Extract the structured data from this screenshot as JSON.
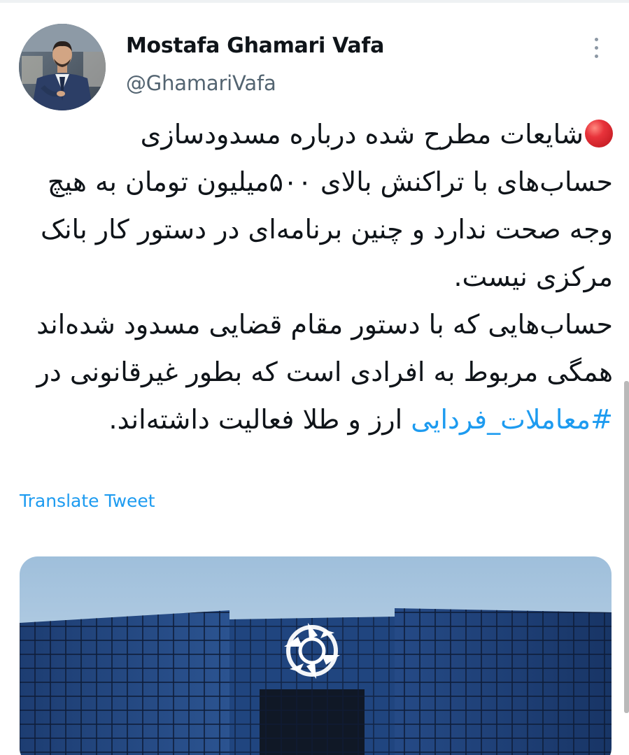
{
  "tweet": {
    "author_name": "Mostafa Ghamari Vafa",
    "author_handle": "@GhamariVafa",
    "paragraph_1": "شایعات مطرح شده درباره مسدودسازی حساب‌های با تراکنش بالای ۵۰۰میلیون تومان به هیچ وجه صحت ندارد و چنین برنامه‌ای در دستور کار بانک مرکزی نیست.",
    "paragraph_2_before": "حساب‌هایی که با دستور مقام قضایی مسدود شده‌اند همگی مربوط به افرادی است که بطور غیرقانونی در ",
    "hashtag": "#معاملات_فردایی",
    "paragraph_2_after": " ارز و طلا فعالیت داشته‌اند.",
    "translate_label": "Translate Tweet"
  },
  "icons": {
    "more": "more-vertical-icon",
    "bullet": "red-circle-emoji"
  },
  "colors": {
    "link": "#1d9bf0",
    "text": "#0f1419",
    "secondary": "#536471"
  }
}
